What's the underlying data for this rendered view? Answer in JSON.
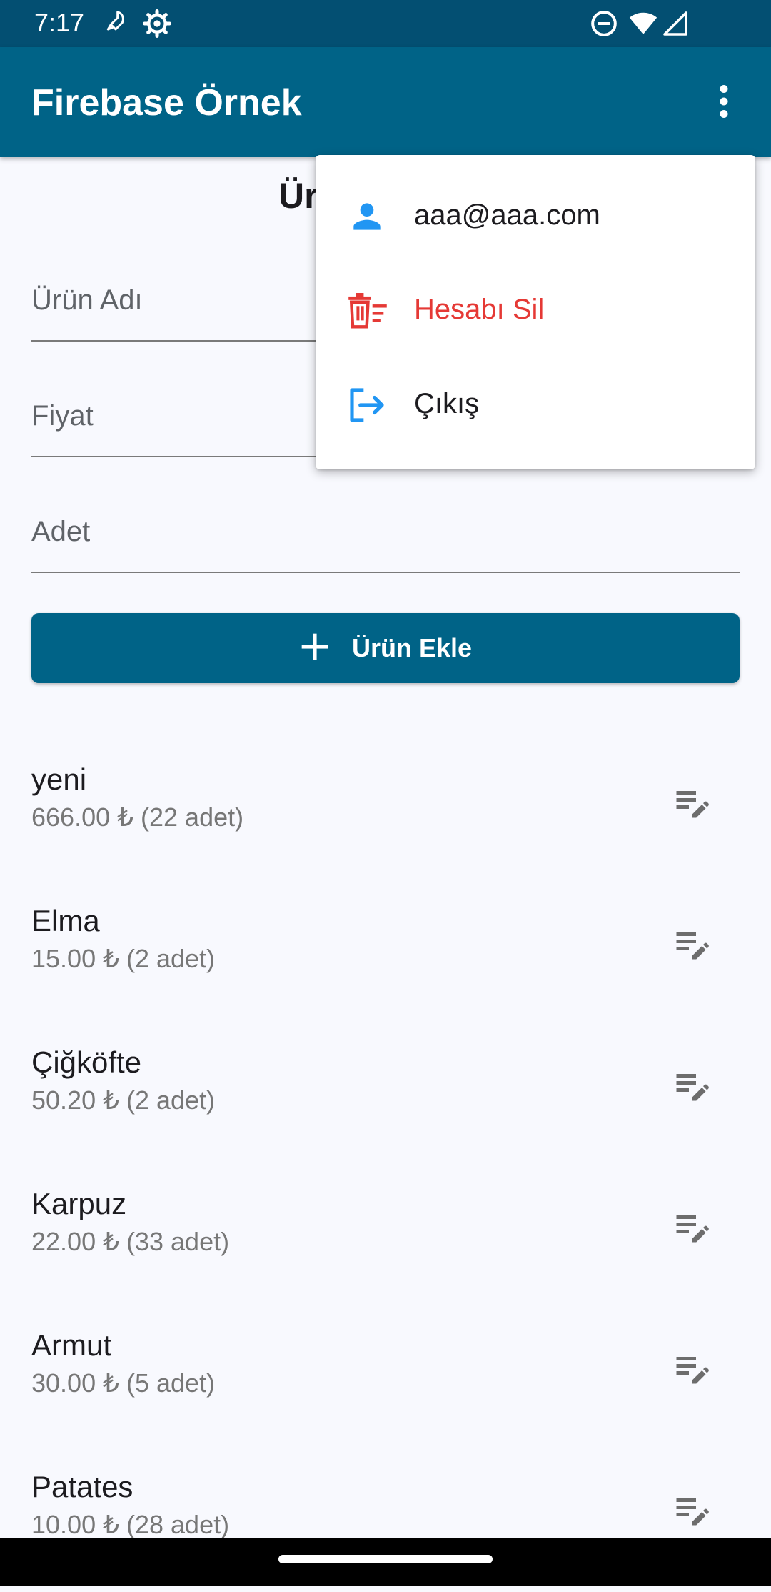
{
  "status_bar": {
    "time": "7:17",
    "icons": [
      "rocket-icon",
      "settings-icon",
      "do-not-disturb-icon",
      "wifi-icon",
      "signal-icon"
    ]
  },
  "app_bar": {
    "title": "Firebase Örnek",
    "menu_icon": "more-vert-icon"
  },
  "form": {
    "title": "Ürün Ekle",
    "fields": [
      {
        "label": "Ürün Adı"
      },
      {
        "label": "Fiyat"
      },
      {
        "label": "Adet"
      }
    ],
    "add_button_label": "Ürün Ekle",
    "add_button_icon": "plus-icon"
  },
  "products": [
    {
      "name": "yeni",
      "detail": "666.00 ₺ (22 adet)"
    },
    {
      "name": "Elma",
      "detail": "15.00 ₺ (2 adet)"
    },
    {
      "name": "Çiğköfte",
      "detail": "50.20 ₺ (2 adet)"
    },
    {
      "name": "Karpuz",
      "detail": "22.00 ₺ (33 adet)"
    },
    {
      "name": "Armut",
      "detail": "30.00 ₺ (5 adet)"
    },
    {
      "name": "Patates",
      "detail": "10.00 ₺ (28 adet)"
    }
  ],
  "overflow_menu": {
    "items": [
      {
        "label": "aaa@aaa.com",
        "icon": "person-icon"
      },
      {
        "label": "Hesabı Sil",
        "icon": "delete-icon"
      },
      {
        "label": "Çıkış",
        "icon": "logout-icon"
      }
    ]
  },
  "colors": {
    "primary": "#006387",
    "status_bar": "#034f72",
    "danger": "#e53935",
    "accent_icon": "#2196f3",
    "background": "#f8f9fe"
  }
}
